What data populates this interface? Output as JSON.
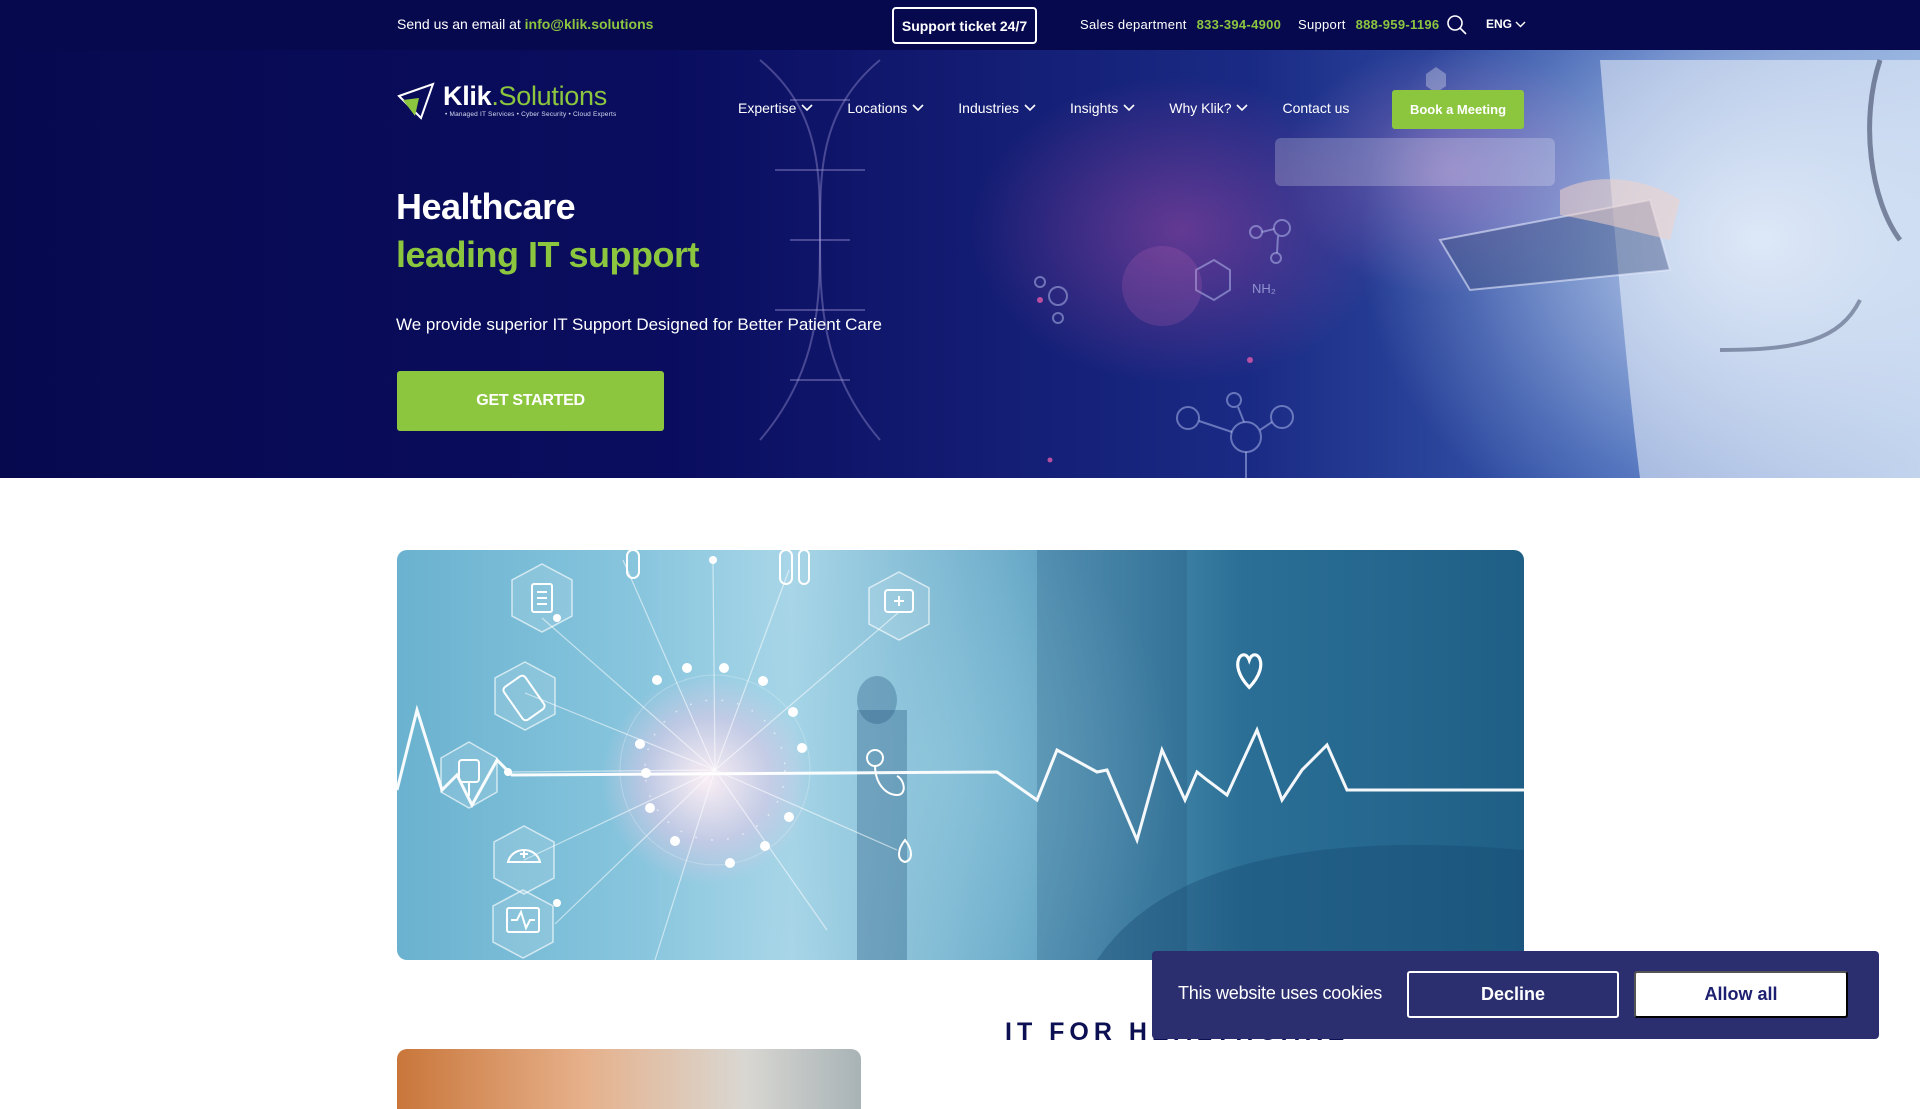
{
  "topbar": {
    "email_prefix": "Send us an email at",
    "email": "info@klik.solutions",
    "support_ticket": "Support ticket 24/7",
    "sales_label": "Sales department",
    "sales_phone": "833-394-4900",
    "support_label": "Support",
    "support_phone": "888-959-1196",
    "language": "ENG"
  },
  "logo": {
    "name_primary": "Klik",
    "name_secondary": ".Solutions",
    "tagline": "• Managed IT Services • Cyber Security • Cloud Experts"
  },
  "nav": {
    "items": [
      {
        "label": "Expertise",
        "dropdown": true
      },
      {
        "label": "Locations",
        "dropdown": true
      },
      {
        "label": "Industries",
        "dropdown": true
      },
      {
        "label": "Insights",
        "dropdown": true
      },
      {
        "label": "Why Klik?",
        "dropdown": true
      },
      {
        "label": "Contact us",
        "dropdown": false
      }
    ],
    "cta": "Book a Meeting"
  },
  "hero": {
    "title": "Healthcare",
    "subtitle": "leading IT support",
    "description": "We provide superior IT Support Designed for Better Patient Care",
    "button": "GET STARTED"
  },
  "section": {
    "title": "IT FOR HEALTHCARE"
  },
  "cookie": {
    "text": "This website uses cookies",
    "decline": "Decline",
    "allow": "Allow all"
  },
  "colors": {
    "navy": "#07094f",
    "accent_green": "#8cc63f",
    "cookie_bg": "#2b2e6f"
  }
}
